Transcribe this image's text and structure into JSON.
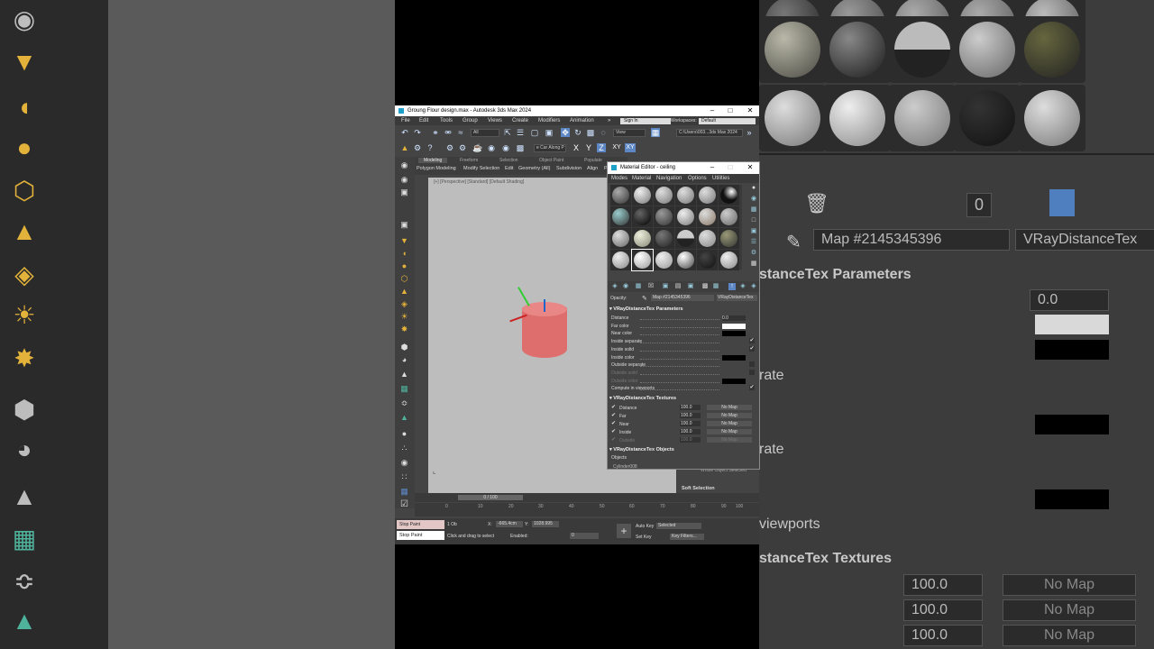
{
  "window": {
    "title": "Groung Flour design.max - Autodesk 3ds Max 2024",
    "menus": [
      "File",
      "Edit",
      "Tools",
      "Group",
      "Views",
      "Create",
      "Modifiers",
      "Animation"
    ],
    "signin": "Sign In",
    "workspaces_label": "Workspaces:",
    "workspace_value": "Default",
    "selection_filter": "All",
    "ref_coord": "View",
    "path_field": "C:\\Users\\003...3ds Max 2024",
    "snap_label": "e Car Along P",
    "axis_labels": [
      "X",
      "Y",
      "Z",
      "XY",
      "XY"
    ]
  },
  "ribbon": {
    "tabs": [
      "Modeling",
      "Freeform",
      "Selection",
      "Object Paint",
      "Populate"
    ],
    "subitems": [
      "Polygon Modeling",
      "Modify Selection",
      "Edit",
      "Geometry (All)",
      "Subdivision",
      "Align",
      "P"
    ]
  },
  "viewport": {
    "label": "[+] [Perspective] [Standard] [Default Shading]"
  },
  "timeline": {
    "slider": "0 / 100",
    "ticks": [
      "0",
      "10",
      "20",
      "30",
      "40",
      "50",
      "60",
      "70",
      "80",
      "90",
      "100"
    ]
  },
  "status": {
    "script_label": "Stop Paint",
    "script_label2": "Stop Paint",
    "selected": "1 Ob",
    "x_val": "-665.4cm",
    "y_val": "1028.995",
    "prompt": "Click and drag to select",
    "enabled": "Enabled:",
    "frame": "0",
    "auto_key": "Auto Key",
    "set_key": "Set Key",
    "selected_dd": "Selected",
    "key_filters": "Key Filters..."
  },
  "material_editor": {
    "title": "Material Editor - ceiling",
    "menus": [
      "Modes",
      "Material",
      "Navigation",
      "Options",
      "Utilities"
    ],
    "opacity_label": "Opacity:",
    "map_name": "Map #2145345396",
    "map_type": "VRayDistanceTex",
    "params_header": "VRayDistanceTex Parameters",
    "params": [
      {
        "label": "Distance",
        "value": "0.0",
        "type": "spin"
      },
      {
        "label": "Far color",
        "color": "#ffffff",
        "type": "color"
      },
      {
        "label": "Near color",
        "color": "#000000",
        "type": "color"
      },
      {
        "label": "Inside separate",
        "checked": "✔",
        "type": "check"
      },
      {
        "label": "Inside solid",
        "checked": "✔",
        "type": "check"
      },
      {
        "label": "Inside color",
        "color": "#000000",
        "type": "color"
      },
      {
        "label": "Outside separate",
        "checked": "",
        "type": "check"
      },
      {
        "label": "Outside solid",
        "checked": "",
        "type": "check",
        "disabled": true
      },
      {
        "label": "Outside color",
        "color": "#000000",
        "type": "color",
        "disabled": true
      },
      {
        "label": "Compute in viewports",
        "checked": "✔",
        "type": "check"
      }
    ],
    "textures_header": "VRayDistanceTex Textures",
    "textures": [
      {
        "name": "Distance",
        "value": "100.0",
        "map": "No Map"
      },
      {
        "name": "Far",
        "value": "100.0",
        "map": "No Map"
      },
      {
        "name": "Near",
        "value": "100.0",
        "map": "No Map"
      },
      {
        "name": "Inside",
        "value": "100.0",
        "map": "No Map"
      },
      {
        "name": "Outside",
        "value": "100.0",
        "map": "No Map",
        "disabled": true
      }
    ],
    "objects_header": "VRayDistanceTex Objects",
    "objects_label": "Objects",
    "objects_item": "Cylinder008"
  },
  "command_panel": {
    "whole_object": "Whole Object Selected",
    "soft_selection": "Soft Selection"
  },
  "background_right": {
    "map_name": "Map #2145345396",
    "map_type": "VRayDistanceTex",
    "params_header": "stanceTex Parameters",
    "distance_value": "0.0",
    "rows": [
      "rate",
      "rate",
      "d",
      "r"
    ],
    "viewports": "viewports",
    "textures_header": "stanceTex Textures",
    "tex_values": [
      "100.0",
      "100.0",
      "100.0"
    ],
    "no_map": [
      "No Map",
      "No Map",
      "No Map"
    ],
    "zero_field": "0"
  },
  "colors": {
    "cylinder": "#de6e6e",
    "accent": "#5c87c4",
    "viewport_bg": "#bdbdbd"
  }
}
